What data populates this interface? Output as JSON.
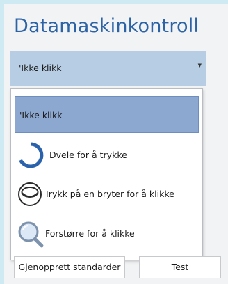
{
  "page": {
    "title": "Datamaskinkontroll"
  },
  "control_mode": {
    "selected_value": "'Ikke klikk",
    "options": [
      {
        "label": "'Ikke klikk",
        "selected": true,
        "icon": "none"
      },
      {
        "label": "Dvele for å trykke",
        "selected": false,
        "icon": "dwell-progress-icon"
      },
      {
        "label": "Trykk på en bryter for å klikke",
        "selected": false,
        "icon": "switch-icon"
      },
      {
        "label": "Forstørre for å klikke",
        "selected": false,
        "icon": "magnifier-icon"
      }
    ]
  },
  "buttons": {
    "restore_label": "Gjenopprett standarder",
    "test_label": "Test"
  },
  "colors": {
    "title": "#2c63a6",
    "combo_bg": "#b6cde3",
    "selected_bg": "#8ca8d1",
    "accent_blue": "#2a63ac",
    "background": "#f2f3f4"
  }
}
